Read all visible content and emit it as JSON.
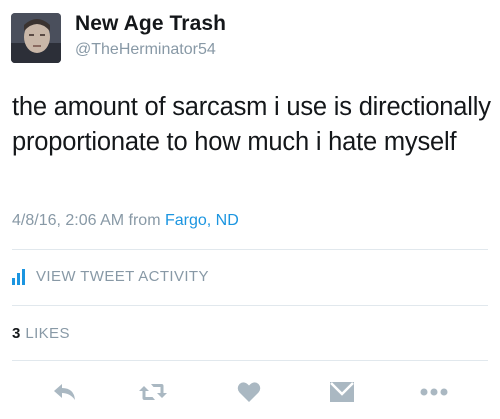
{
  "user": {
    "display_name": "New Age Trash",
    "handle": "@TheHerminator54"
  },
  "tweet": {
    "text": "the amount of sarcasm i use is directionally proportionate to how much i hate myself",
    "timestamp": "4/8/16, 2:06 AM",
    "from_word": "from",
    "location": "Fargo, ND"
  },
  "activity": {
    "label": "VIEW TWEET ACTIVITY",
    "icon": "bar-chart-icon"
  },
  "likes": {
    "count": "3",
    "label": "LIKES"
  },
  "actions": [
    {
      "icon": "reply-icon"
    },
    {
      "icon": "retweet-icon"
    },
    {
      "icon": "heart-icon"
    },
    {
      "icon": "direct-message-icon"
    },
    {
      "icon": "more-icon"
    }
  ],
  "colors": {
    "text": "#14171a",
    "muted": "#8899a6",
    "link": "#1b95e0",
    "action_icon": "#aab8c2",
    "divider": "#e1e8ed"
  }
}
